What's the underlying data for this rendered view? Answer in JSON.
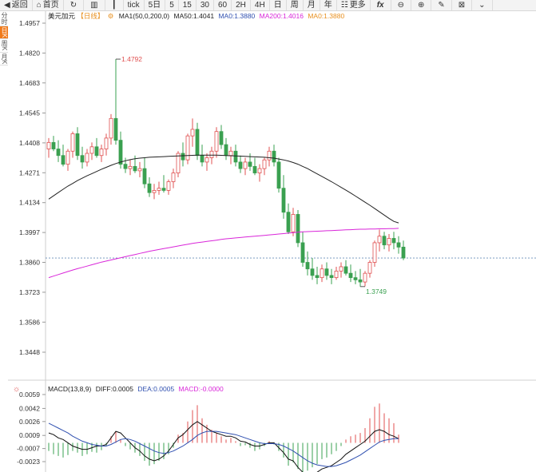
{
  "toolbar": {
    "back": "返回",
    "home": "首页",
    "tick": "tick",
    "periods": [
      "5日",
      "5",
      "15",
      "30",
      "60",
      "2H",
      "4H",
      "日",
      "周",
      "月",
      "年"
    ],
    "more": "更多"
  },
  "side_tabs": [
    "分时",
    "日K",
    "周K",
    "月K"
  ],
  "colors": {
    "up": "#e05050",
    "down": "#3aa050",
    "ma50": "#222222",
    "ma200": "#d926d9",
    "ma0": "#e89020",
    "diff": "#111111",
    "dea": "#3050b0"
  },
  "legend": {
    "symbol": "美元加元",
    "period_tag": "【日线】",
    "ma_title": "MA1(50,0,200,0)",
    "ma50": "MA50:1.4041",
    "ma0a": "MA0:1.3880",
    "ma200": "MA200:1.4016",
    "ma0b": "MA0:1.3880"
  },
  "macd_legend": {
    "title": "MACD(13,8,9)",
    "diff": "DIFF:0.0005",
    "dea": "DEA:0.0005",
    "macd": "MACD:-0.0000"
  },
  "annotations": {
    "high": "1.4792",
    "low": "1.3749"
  },
  "chart_data": {
    "type": "candlestick",
    "y_ticks": [
      "1.4957",
      "1.4820",
      "1.4683",
      "1.4545",
      "1.4408",
      "1.4271",
      "1.4134",
      "1.3997",
      "1.3860",
      "1.3723",
      "1.3586",
      "1.3448"
    ],
    "ylim": [
      1.3378,
      1.4957
    ],
    "last_price_line": 1.388,
    "macd_y_ticks": [
      "0.0059",
      "0.0042",
      "0.0026",
      "0.0009",
      "-0.0007",
      "-0.0023"
    ],
    "macd_ylim": [
      -0.004,
      0.0059
    ],
    "candles": [
      [
        1.438,
        1.443,
        1.434,
        1.441
      ],
      [
        1.441,
        1.444,
        1.437,
        1.438
      ],
      [
        1.438,
        1.442,
        1.432,
        1.435
      ],
      [
        1.435,
        1.44,
        1.43,
        1.431
      ],
      [
        1.431,
        1.438,
        1.428,
        1.437
      ],
      [
        1.437,
        1.446,
        1.434,
        1.445
      ],
      [
        1.445,
        1.448,
        1.433,
        1.435
      ],
      [
        1.435,
        1.439,
        1.429,
        1.432
      ],
      [
        1.432,
        1.438,
        1.43,
        1.436
      ],
      [
        1.436,
        1.441,
        1.433,
        1.439
      ],
      [
        1.439,
        1.443,
        1.434,
        1.435
      ],
      [
        1.435,
        1.44,
        1.432,
        1.438
      ],
      [
        1.438,
        1.445,
        1.435,
        1.443
      ],
      [
        1.443,
        1.454,
        1.44,
        1.452
      ],
      [
        1.452,
        1.4792,
        1.44,
        1.442
      ],
      [
        1.442,
        1.446,
        1.429,
        1.431
      ],
      [
        1.431,
        1.434,
        1.427,
        1.429
      ],
      [
        1.429,
        1.433,
        1.426,
        1.43
      ],
      [
        1.43,
        1.435,
        1.427,
        1.428
      ],
      [
        1.428,
        1.432,
        1.425,
        1.429
      ],
      [
        1.429,
        1.434,
        1.42,
        1.422
      ],
      [
        1.422,
        1.425,
        1.416,
        1.418
      ],
      [
        1.418,
        1.422,
        1.415,
        1.419
      ],
      [
        1.419,
        1.423,
        1.417,
        1.42
      ],
      [
        1.42,
        1.426,
        1.418,
        1.419
      ],
      [
        1.419,
        1.424,
        1.417,
        1.423
      ],
      [
        1.423,
        1.429,
        1.42,
        1.427
      ],
      [
        1.427,
        1.437,
        1.425,
        1.436
      ],
      [
        1.436,
        1.441,
        1.43,
        1.433
      ],
      [
        1.433,
        1.445,
        1.431,
        1.444
      ],
      [
        1.444,
        1.452,
        1.439,
        1.447
      ],
      [
        1.447,
        1.45,
        1.433,
        1.435
      ],
      [
        1.435,
        1.44,
        1.43,
        1.432
      ],
      [
        1.432,
        1.436,
        1.428,
        1.434
      ],
      [
        1.434,
        1.439,
        1.431,
        1.437
      ],
      [
        1.437,
        1.448,
        1.434,
        1.446
      ],
      [
        1.446,
        1.449,
        1.438,
        1.44
      ],
      [
        1.44,
        1.443,
        1.433,
        1.435
      ],
      [
        1.435,
        1.439,
        1.431,
        1.437
      ],
      [
        1.437,
        1.44,
        1.43,
        1.432
      ],
      [
        1.432,
        1.435,
        1.427,
        1.429
      ],
      [
        1.429,
        1.434,
        1.426,
        1.432
      ],
      [
        1.432,
        1.436,
        1.428,
        1.43
      ],
      [
        1.43,
        1.434,
        1.426,
        1.427
      ],
      [
        1.427,
        1.431,
        1.423,
        1.429
      ],
      [
        1.429,
        1.434,
        1.426,
        1.433
      ],
      [
        1.433,
        1.439,
        1.43,
        1.437
      ],
      [
        1.437,
        1.44,
        1.43,
        1.432
      ],
      [
        1.432,
        1.434,
        1.418,
        1.42
      ],
      [
        1.42,
        1.426,
        1.406,
        1.409
      ],
      [
        1.409,
        1.413,
        1.399,
        1.4
      ],
      [
        1.4,
        1.411,
        1.398,
        1.408
      ],
      [
        1.408,
        1.41,
        1.393,
        1.395
      ],
      [
        1.395,
        1.4,
        1.384,
        1.386
      ],
      [
        1.386,
        1.391,
        1.38,
        1.383
      ],
      [
        1.383,
        1.388,
        1.378,
        1.38
      ],
      [
        1.38,
        1.384,
        1.376,
        1.379
      ],
      [
        1.379,
        1.385,
        1.377,
        1.383
      ],
      [
        1.383,
        1.386,
        1.378,
        1.38
      ],
      [
        1.38,
        1.383,
        1.376,
        1.379
      ],
      [
        1.379,
        1.384,
        1.378,
        1.382
      ],
      [
        1.382,
        1.386,
        1.379,
        1.384
      ],
      [
        1.384,
        1.387,
        1.38,
        1.381
      ],
      [
        1.381,
        1.385,
        1.377,
        1.379
      ],
      [
        1.379,
        1.382,
        1.376,
        1.378
      ],
      [
        1.378,
        1.383,
        1.3749,
        1.377
      ],
      [
        1.377,
        1.382,
        1.375,
        1.381
      ],
      [
        1.381,
        1.387,
        1.379,
        1.386
      ],
      [
        1.386,
        1.396,
        1.384,
        1.395
      ],
      [
        1.395,
        1.401,
        1.391,
        1.398
      ],
      [
        1.398,
        1.4,
        1.392,
        1.394
      ],
      [
        1.394,
        1.399,
        1.391,
        1.397
      ],
      [
        1.397,
        1.4,
        1.392,
        1.395
      ],
      [
        1.395,
        1.398,
        1.39,
        1.393
      ],
      [
        1.393,
        1.396,
        1.387,
        1.388
      ]
    ],
    "ma50": [
      1.415,
      1.4165,
      1.418,
      1.4195,
      1.421,
      1.4222,
      1.4235,
      1.4246,
      1.4257,
      1.4267,
      1.4277,
      1.4287,
      1.4296,
      1.4305,
      1.4313,
      1.432,
      1.4326,
      1.4331,
      1.4335,
      1.4338,
      1.434,
      1.4342,
      1.4343,
      1.4344,
      1.4345,
      1.4346,
      1.4347,
      1.4348,
      1.4349,
      1.435,
      1.4351,
      1.4352,
      1.4352,
      1.4352,
      1.4352,
      1.4352,
      1.4351,
      1.435,
      1.4349,
      1.4348,
      1.4347,
      1.4346,
      1.4345,
      1.4344,
      1.4343,
      1.4342,
      1.434,
      1.4338,
      1.4334,
      1.433,
      1.4325,
      1.4318,
      1.431,
      1.43,
      1.429,
      1.4278,
      1.4266,
      1.4254,
      1.4242,
      1.423,
      1.4217,
      1.4204,
      1.4191,
      1.4178,
      1.4164,
      1.415,
      1.4136,
      1.4122,
      1.4107,
      1.4092,
      1.4077,
      1.4062,
      1.4048,
      1.4041
    ],
    "ma200": [
      1.379,
      1.3797,
      1.3804,
      1.3811,
      1.3818,
      1.3825,
      1.3831,
      1.3837,
      1.3843,
      1.3849,
      1.3855,
      1.3861,
      1.3866,
      1.3871,
      1.3876,
      1.3881,
      1.3886,
      1.3891,
      1.3896,
      1.3901,
      1.3906,
      1.3911,
      1.3915,
      1.3919,
      1.3923,
      1.3927,
      1.3931,
      1.3935,
      1.3939,
      1.3943,
      1.3947,
      1.395,
      1.3953,
      1.3956,
      1.3959,
      1.3962,
      1.3965,
      1.3968,
      1.397,
      1.3972,
      1.3974,
      1.3976,
      1.3978,
      1.398,
      1.3982,
      1.3984,
      1.3986,
      1.3988,
      1.399,
      1.3992,
      1.3994,
      1.3996,
      1.3998,
      1.4,
      1.4001,
      1.4002,
      1.4003,
      1.4004,
      1.4005,
      1.4006,
      1.4007,
      1.4008,
      1.4009,
      1.401,
      1.4011,
      1.4012,
      1.4012,
      1.4013,
      1.4013,
      1.4014,
      1.4014,
      1.4015,
      1.4015,
      1.4016
    ],
    "macd_hist": [
      -0.001,
      -0.0014,
      -0.0016,
      -0.0018,
      -0.0015,
      -0.001,
      -0.0012,
      -0.0016,
      -0.0014,
      -0.0011,
      -0.0012,
      -0.0009,
      -0.0004,
      0.0008,
      0.0014,
      0.0004,
      -0.0004,
      -0.0008,
      -0.0012,
      -0.0016,
      -0.0022,
      -0.0028,
      -0.0026,
      -0.0022,
      -0.002,
      -0.0014,
      -0.0006,
      0.001,
      0.0012,
      0.0026,
      0.004,
      0.0046,
      0.003,
      0.0022,
      0.0016,
      0.0012,
      0.0008,
      0.0004,
      0.0006,
      0.0002,
      -0.0004,
      -0.0003,
      -0.0006,
      -0.001,
      -0.0008,
      -0.0004,
      0.0002,
      -0.0002,
      -0.001,
      -0.0018,
      -0.0028,
      -0.0024,
      -0.0032,
      -0.0036,
      -0.0034,
      -0.003,
      -0.0026,
      -0.002,
      -0.0018,
      -0.0014,
      -0.001,
      -0.0004,
      0.0004,
      0.0008,
      0.001,
      0.0012,
      0.0018,
      0.003,
      0.0044,
      0.0048,
      0.0036,
      0.003,
      0.0024,
      0.001
    ],
    "macd_diff": [
      0.0012,
      0.001,
      0.0006,
      0.0004,
      0.0,
      -0.0004,
      -0.0006,
      -0.0008,
      -0.0008,
      -0.0006,
      -0.0004,
      -0.0004,
      -0.0002,
      0.0006,
      0.0014,
      0.0012,
      0.0006,
      0.0,
      -0.0006,
      -0.001,
      -0.0016,
      -0.002,
      -0.0022,
      -0.002,
      -0.0016,
      -0.001,
      -0.0002,
      0.0006,
      0.001,
      0.0016,
      0.0022,
      0.0026,
      0.0022,
      0.0018,
      0.0014,
      0.0012,
      0.001,
      0.0008,
      0.0008,
      0.0006,
      0.0002,
      0.0001,
      -0.0002,
      -0.0004,
      -0.0004,
      -0.0002,
      0.0,
      0.0,
      -0.0006,
      -0.0012,
      -0.002,
      -0.0022,
      -0.003,
      -0.0036,
      -0.0038,
      -0.0038,
      -0.0036,
      -0.0032,
      -0.003,
      -0.0028,
      -0.0024,
      -0.002,
      -0.0014,
      -0.001,
      -0.0006,
      -0.0002,
      0.0002,
      0.0008,
      0.0014,
      0.0016,
      0.0014,
      0.001,
      0.0008,
      0.0005
    ],
    "macd_dea": [
      0.0024,
      0.0021,
      0.0018,
      0.0015,
      0.0012,
      0.0008,
      0.0005,
      0.0002,
      0.0,
      -0.0002,
      -0.0003,
      -0.0004,
      -0.0004,
      -0.0002,
      0.0001,
      0.0004,
      0.0005,
      0.0004,
      0.0002,
      -0.0001,
      -0.0004,
      -0.0007,
      -0.001,
      -0.0012,
      -0.0013,
      -0.0012,
      -0.001,
      -0.0007,
      -0.0004,
      0.0,
      0.0004,
      0.0009,
      0.0012,
      0.0014,
      0.0014,
      0.0014,
      0.0013,
      0.0012,
      0.0011,
      0.001,
      0.0008,
      0.0006,
      0.0004,
      0.0002,
      0.0,
      -0.0001,
      -0.0001,
      -0.0001,
      -0.0002,
      -0.0004,
      -0.0007,
      -0.001,
      -0.0014,
      -0.0018,
      -0.0022,
      -0.0025,
      -0.0027,
      -0.0028,
      -0.0029,
      -0.0029,
      -0.0028,
      -0.0026,
      -0.0024,
      -0.0021,
      -0.0018,
      -0.0015,
      -0.0011,
      -0.0007,
      -0.0003,
      0.0001,
      0.0003,
      0.0004,
      0.0005,
      0.0005
    ]
  }
}
